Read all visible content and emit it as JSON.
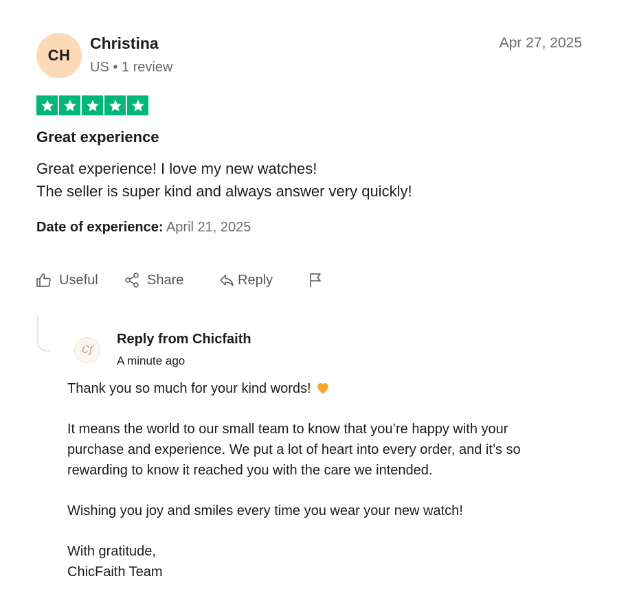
{
  "reviewer": {
    "initials": "CH",
    "name": "Christina",
    "meta": "US • 1 review",
    "avatar_color": "#fdd9b8"
  },
  "review": {
    "date": "Apr 27, 2025",
    "rating": 5,
    "star_color": "#00b67a",
    "title": "Great experience",
    "body_lines": [
      "Great experience! I love my new watches!",
      "The seller is super kind and always answer very quickly!"
    ],
    "experience_label": "Date of experience:",
    "experience_date": "April 21, 2025"
  },
  "actions": {
    "useful_label": "Useful",
    "share_label": "Share",
    "reply_label": "Reply",
    "useful_icon": "thumbs-up-icon",
    "share_icon": "share-icon",
    "reply_icon": "reply-arrow-icon",
    "flag_icon": "flag-icon"
  },
  "company_reply": {
    "logo_text": "Cf",
    "from": "Reply from Chicfaith",
    "time": "A minute ago",
    "paragraphs": [
      [
        "Thank you so much for your kind words!"
      ],
      [
        "It means the world to our small team to know that you’re happy with your",
        "purchase and experience. We put a lot of heart into every order, and it’s so",
        "rewarding to know it reached you with the care we intended."
      ],
      [
        "Wishing you joy and smiles every time you wear your new watch!"
      ],
      [
        "With gratitude,",
        "ChicFaith Team"
      ]
    ],
    "emoji_icon": "orange-heart-icon"
  }
}
